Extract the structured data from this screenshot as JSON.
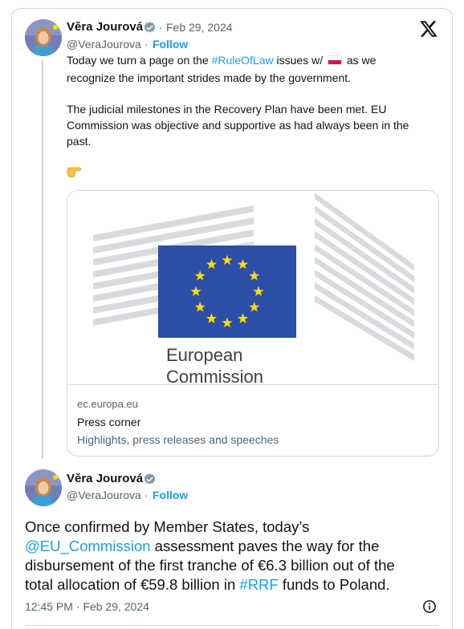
{
  "tweet1": {
    "author_name": "Věra Jourová",
    "handle": "@VeraJourova",
    "separator": "·",
    "date": "Feb 29, 2024",
    "follow_label": "Follow",
    "line1_pre": "Today we turn a page on the ",
    "line1_hashtag": "#RuleOfLaw",
    "line1_mid": " issues w/ ",
    "line1_post": " as we",
    "line2": "recognize the important strides made by the government.",
    "para2_line1": "The judicial milestones in the Recovery Plan have been met. EU",
    "para2_line2": "Commission was objective and supportive as had always been in the",
    "para2_line3": "past.",
    "pointing_icon": "backhand-index-pointing-right-icon",
    "link_card": {
      "logo_line1": "European",
      "logo_line2": "Commission",
      "domain": "ec.europa.eu",
      "title": "Press corner",
      "description": "Highlights, press releases and speeches"
    }
  },
  "tweet2": {
    "author_name": "Věra Jourová",
    "handle": "@VeraJourova",
    "separator": "·",
    "follow_label": "Follow",
    "text_l1": "Once confirmed by Member States, today’s",
    "text_mention": "@EU_Commission",
    "text_l2_post": " assessment paves the way for the",
    "text_l3": "disbursement of the first tranche of €6.3 billion out of the",
    "text_l4_pre": "total allocation of €59.8 billion in ",
    "text_hashtag": "#RRF",
    "text_l4_post": " funds to Poland.",
    "time": "12:45 PM",
    "date": "Feb 29, 2024"
  },
  "colors": {
    "link": "#1d9bf0",
    "secondary_text": "#536471",
    "border": "#cfd9de",
    "eu_blue": "#2b4ea7",
    "eu_star": "#ffdd00",
    "verified": "#829aab"
  }
}
